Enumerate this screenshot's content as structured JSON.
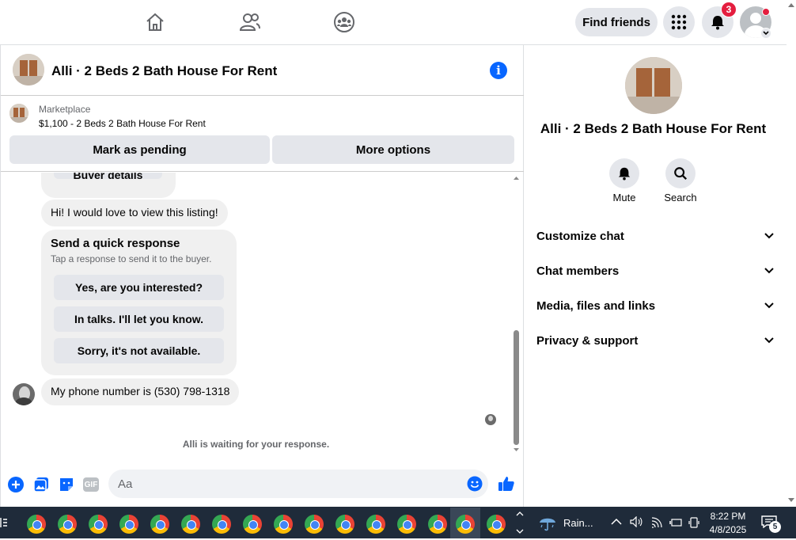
{
  "nav": {
    "find_friends_label": "Find friends",
    "notification_count": "3"
  },
  "chat": {
    "title": "Alli · 2 Beds 2 Bath House For Rent",
    "listing": {
      "source_label": "Marketplace",
      "price_title": "$1,100 - 2 Beds 2 Bath House For Rent"
    },
    "buttons": {
      "mark_pending": "Mark as pending",
      "more_options": "More options"
    },
    "messages": {
      "buyer_details_label": "Buyer details",
      "msg1": "Hi! I would love to view this listing!",
      "quick_response_title": "Send a quick response",
      "quick_response_sub": "Tap a response to send it to the buyer.",
      "quick_responses": [
        "Yes, are you interested?",
        "In talks. I'll let you know.",
        "Sorry, it's not available."
      ],
      "msg2": "My phone number is (530) 798-1318"
    },
    "waiting_text": "Alli is waiting for your response.",
    "composer": {
      "placeholder": "Aa",
      "gif_label": "GIF"
    }
  },
  "side": {
    "title": "Alli · 2 Beds 2 Bath House For Rent",
    "actions": [
      {
        "label": "Mute",
        "icon": "bell-icon"
      },
      {
        "label": "Search",
        "icon": "search-icon"
      }
    ],
    "sections": [
      "Customize chat",
      "Chat members",
      "Media, files and links",
      "Privacy & support"
    ]
  },
  "taskbar": {
    "weather": "Rain...",
    "time": "8:22 PM",
    "date": "4/8/2025",
    "notification_count": "5"
  },
  "colors": {
    "accent": "#0866ff",
    "badge": "#e41e3f",
    "bubble": "#f0f0f0",
    "button": "#e4e6eb",
    "taskbar": "#1f2b3a"
  }
}
